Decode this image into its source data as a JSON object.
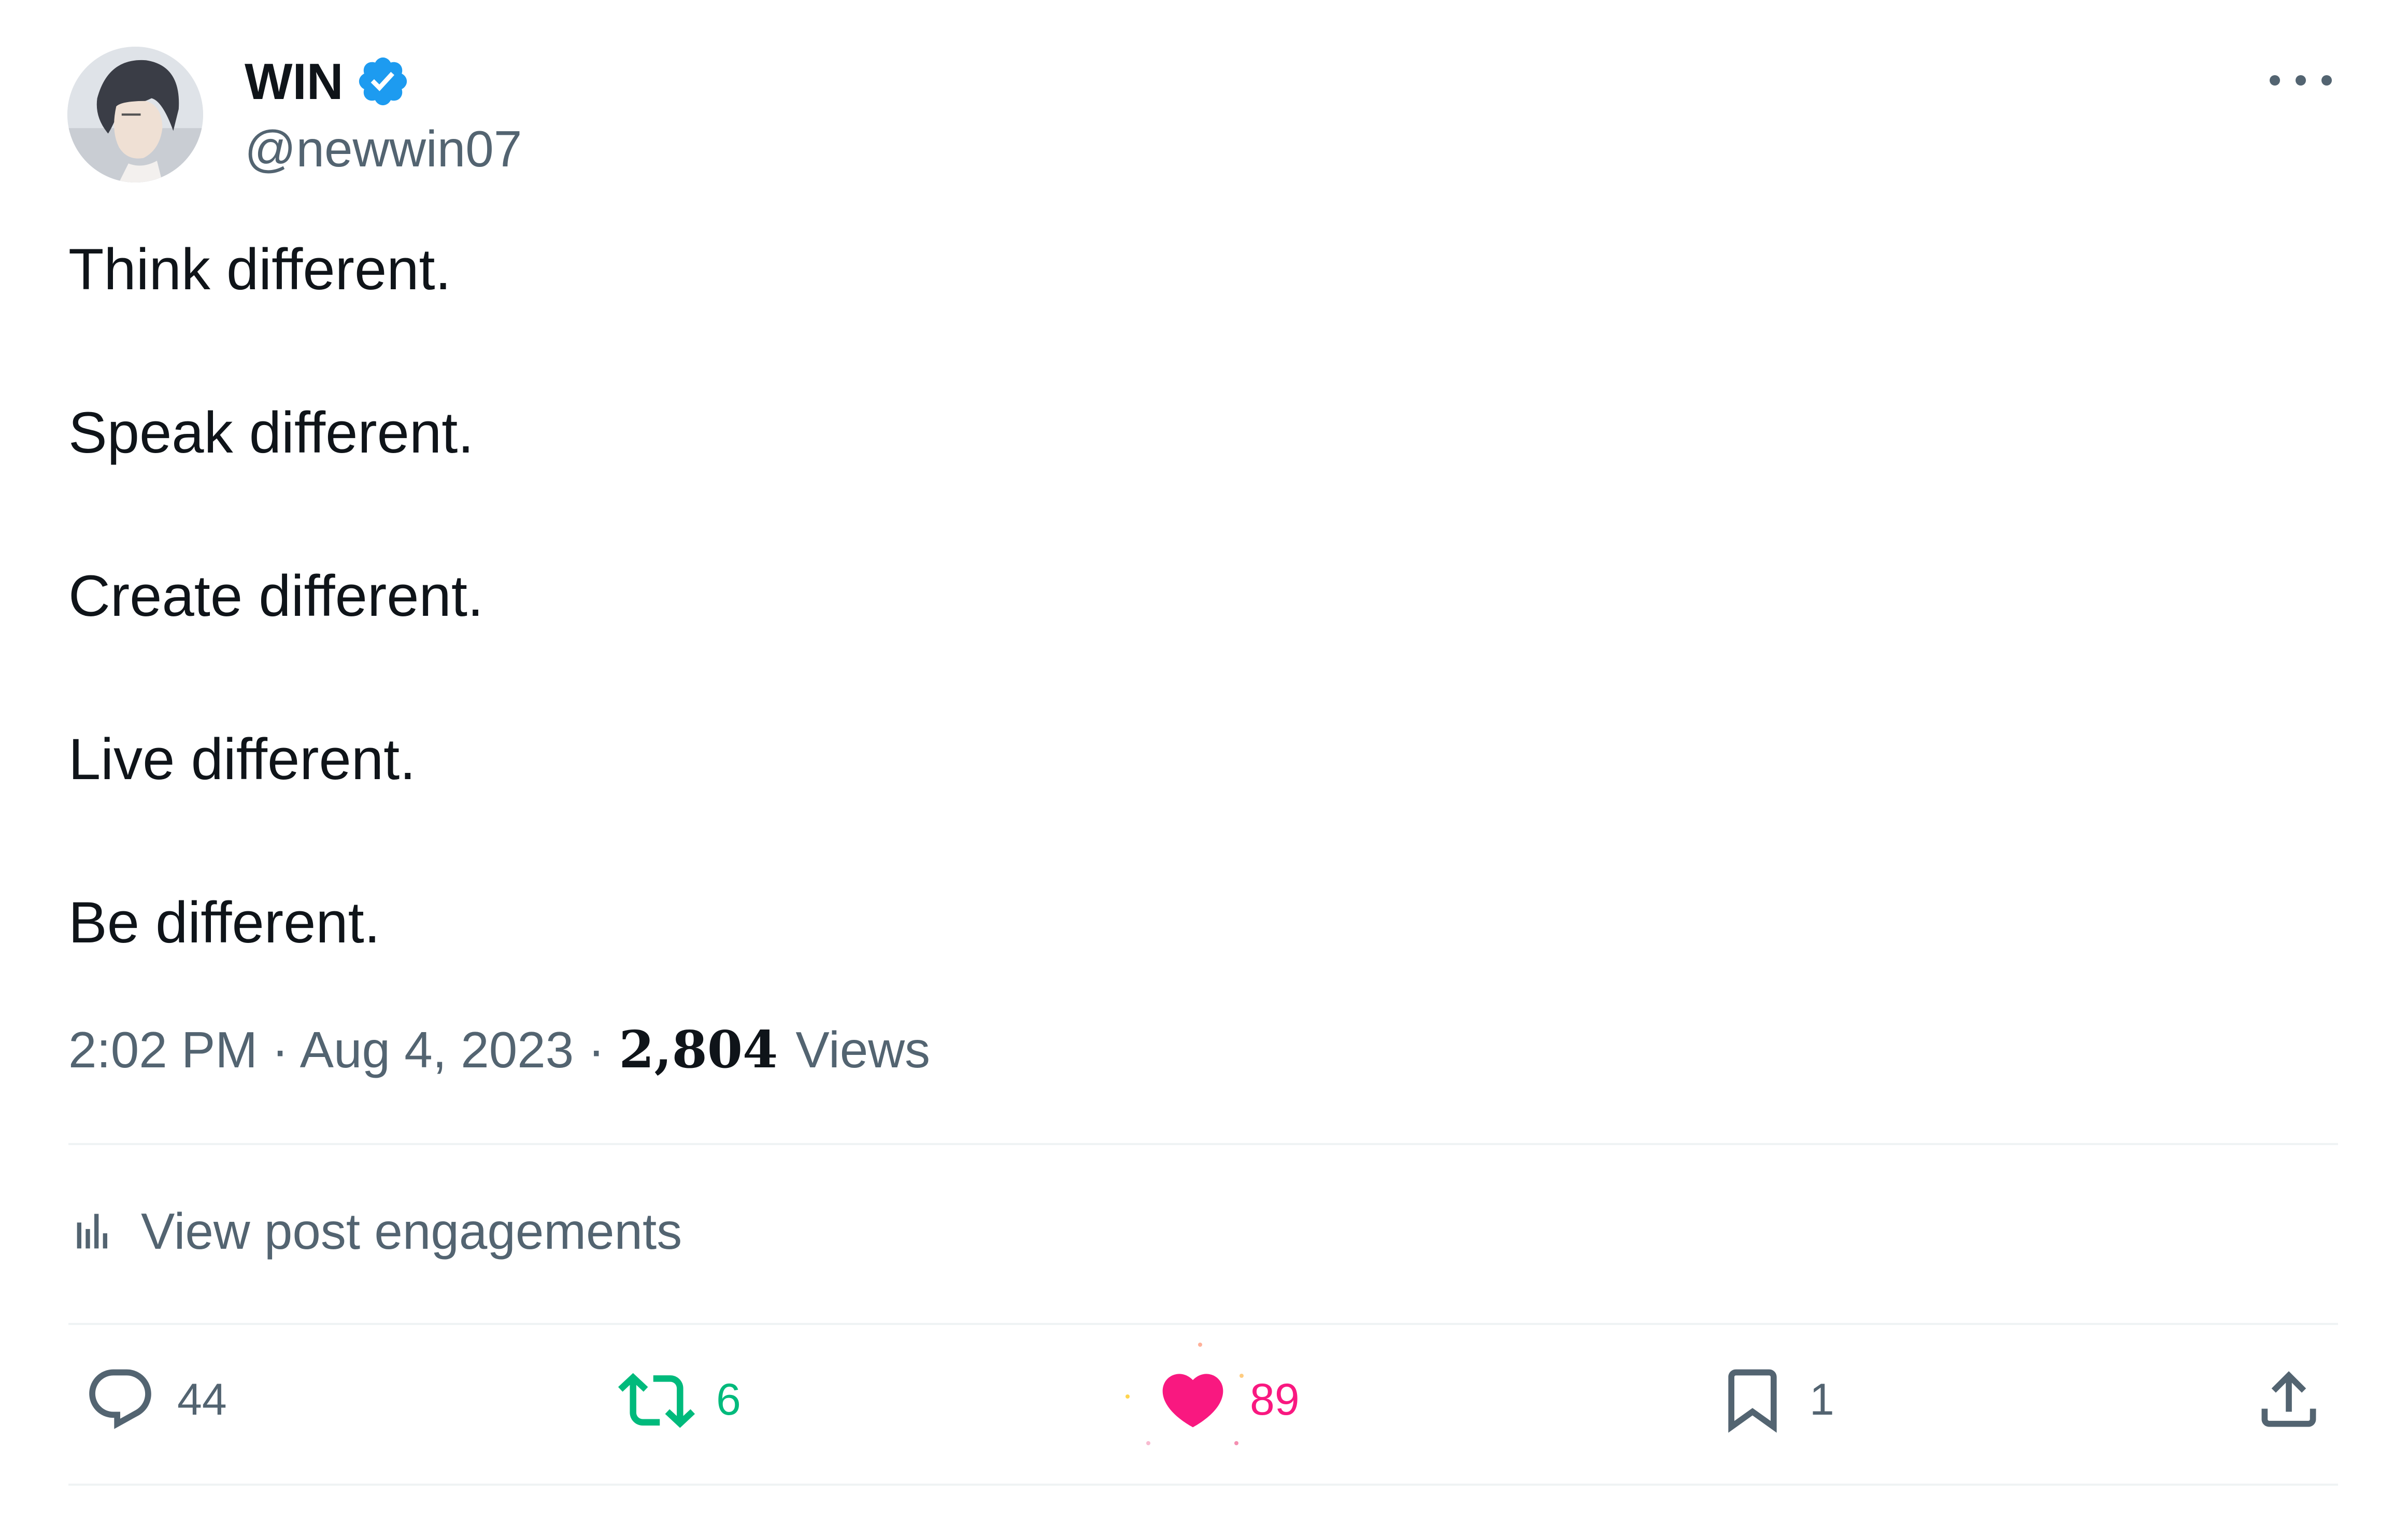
{
  "user": {
    "display_name": "WIN",
    "handle": "@newwin07",
    "verified": true,
    "verified_color": "#1d9bf0",
    "avatar_icon": "user-avatar-photo"
  },
  "post": {
    "lines": [
      "Think different.",
      "Speak different.",
      "Create different.",
      "Live different.",
      "Be different."
    ]
  },
  "meta": {
    "time": "2:02 PM",
    "separator": "·",
    "date": "Aug 4, 2023",
    "views_count": "2,804",
    "views_label": "Views"
  },
  "engagements": {
    "label": "View post engagements",
    "icon": "bar-chart-icon"
  },
  "actions": {
    "reply": {
      "icon": "reply-icon",
      "count": "44",
      "color": "#536471"
    },
    "retweet": {
      "icon": "retweet-icon",
      "count": "6",
      "color": "#00ba7c"
    },
    "like": {
      "icon": "heart-icon",
      "count": "89",
      "color": "#f91880",
      "liked": true
    },
    "bookmark": {
      "icon": "bookmark-icon",
      "count": "1",
      "color": "#536471"
    },
    "share": {
      "icon": "share-icon"
    }
  },
  "colors": {
    "text_primary": "#0f1419",
    "text_secondary": "#536471",
    "divider": "#eff3f4"
  }
}
